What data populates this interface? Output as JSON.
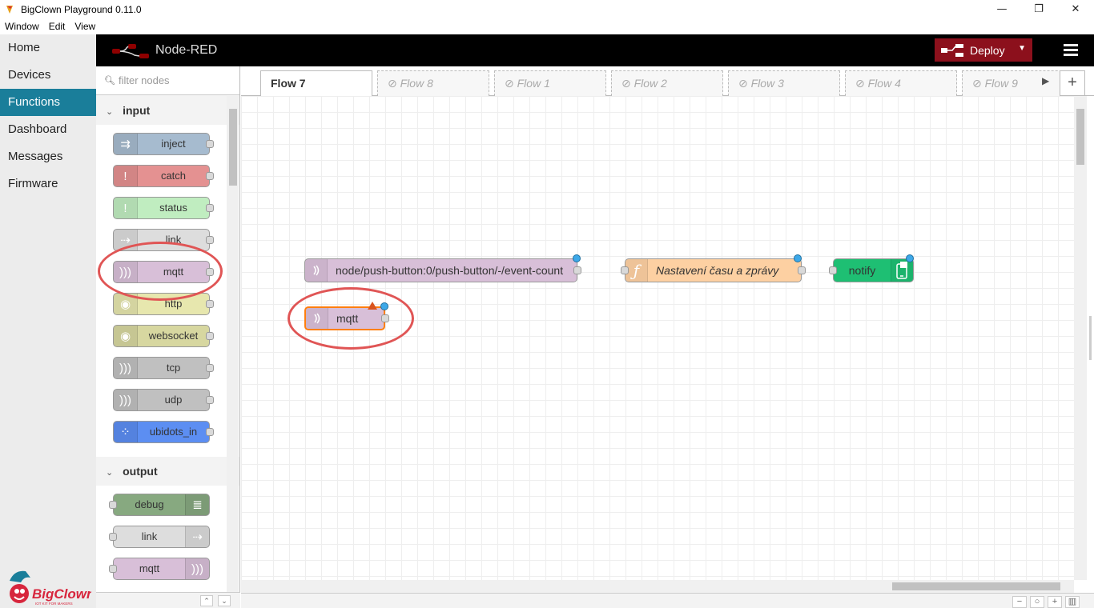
{
  "window": {
    "title": "BigClown Playground 0.11.0",
    "minimize": "—",
    "restore": "❐",
    "close": "✕"
  },
  "menu": [
    "Window",
    "Edit",
    "View"
  ],
  "appnav": {
    "items": [
      {
        "label": "Home"
      },
      {
        "label": "Devices"
      },
      {
        "label": "Functions",
        "active": true
      },
      {
        "label": "Dashboard"
      },
      {
        "label": "Messages"
      },
      {
        "label": "Firmware"
      }
    ],
    "logo_text": "BigClown",
    "logo_tagline": "IOT KIT FOR MAKERS"
  },
  "header": {
    "title": "Node-RED",
    "deploy_label": "Deploy"
  },
  "palette": {
    "filter_placeholder": "filter nodes",
    "categories": [
      {
        "name": "input",
        "nodes": [
          {
            "label": "inject",
            "color": "#a6bbcf",
            "icon": "⇉"
          },
          {
            "label": "catch",
            "color": "#e49191",
            "icon": "!"
          },
          {
            "label": "status",
            "color": "#c0edc0",
            "icon": "!"
          },
          {
            "label": "link",
            "color": "#dddddd",
            "icon": "⇢"
          },
          {
            "label": "mqtt",
            "color": "#d8bfd8",
            "icon": ")))"
          },
          {
            "label": "http",
            "color": "#e7e7ae",
            "icon": "◉"
          },
          {
            "label": "websocket",
            "color": "#d7d7a0",
            "icon": "◉"
          },
          {
            "label": "tcp",
            "color": "#c0c0c0",
            "icon": ")))"
          },
          {
            "label": "udp",
            "color": "#c0c0c0",
            "icon": ")))"
          },
          {
            "label": "ubidots_in",
            "color": "#5c8ef2",
            "icon": "⁘"
          }
        ]
      },
      {
        "name": "output",
        "nodes": [
          {
            "label": "debug",
            "color": "#87a980",
            "icon": "≣"
          },
          {
            "label": "link",
            "color": "#dddddd",
            "icon": "⇢"
          },
          {
            "label": "mqtt",
            "color": "#d8bfd8",
            "icon": ")))"
          }
        ]
      }
    ]
  },
  "tabs": [
    {
      "label": "Flow 7",
      "active": true
    },
    {
      "label": "Flow 8",
      "disabled": true
    },
    {
      "label": "Flow 1",
      "disabled": true
    },
    {
      "label": "Flow 2",
      "disabled": true
    },
    {
      "label": "Flow 3",
      "disabled": true
    },
    {
      "label": "Flow 4",
      "disabled": true
    },
    {
      "label": "Flow 9",
      "disabled": true
    }
  ],
  "disabled_prefix": "⊘ ",
  "flow_nodes": {
    "mqtt_in_topic": {
      "label": "node/push-button:0/push-button/-/event-count",
      "color": "#d8bfd8"
    },
    "function": {
      "label": "Nastavení času a zprávy",
      "color": "#fdd0a2"
    },
    "notify": {
      "label": "notify",
      "color": "#1ebf73"
    },
    "mqtt_new": {
      "label": "mqtt",
      "color": "#d8bfd8"
    }
  },
  "accent_colors": {
    "nav_active": "#1a7e9a",
    "deploy": "#8c101c",
    "annotation": "#e05555",
    "status_dot": "#3da8e8"
  }
}
